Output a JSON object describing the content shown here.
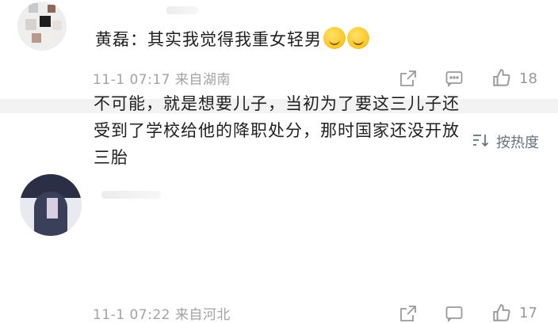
{
  "comments": [
    {
      "author": "黄磊",
      "separator": "：",
      "text": "其实我觉得我重女轻男",
      "emojis": [
        "smirk-emoji",
        "smirk-emoji"
      ],
      "time": "11-1 07:17",
      "location": "来自湖南",
      "likes": "18"
    },
    {
      "text_line1": "不可能，就是想要儿子，当初为了要这三儿子还",
      "text_line2": "受到了学校给他的降职处分，那时国家还没开放",
      "text_line3": "三胎",
      "time": "11-1 07:22",
      "location": "来自河北",
      "likes": "17"
    }
  ],
  "sort": {
    "label": "按热度",
    "icon": "sort-icon"
  },
  "colors": {
    "separator": "#f3f3f3",
    "meta": "#a3a3a3",
    "text": "#1f1f1f"
  }
}
